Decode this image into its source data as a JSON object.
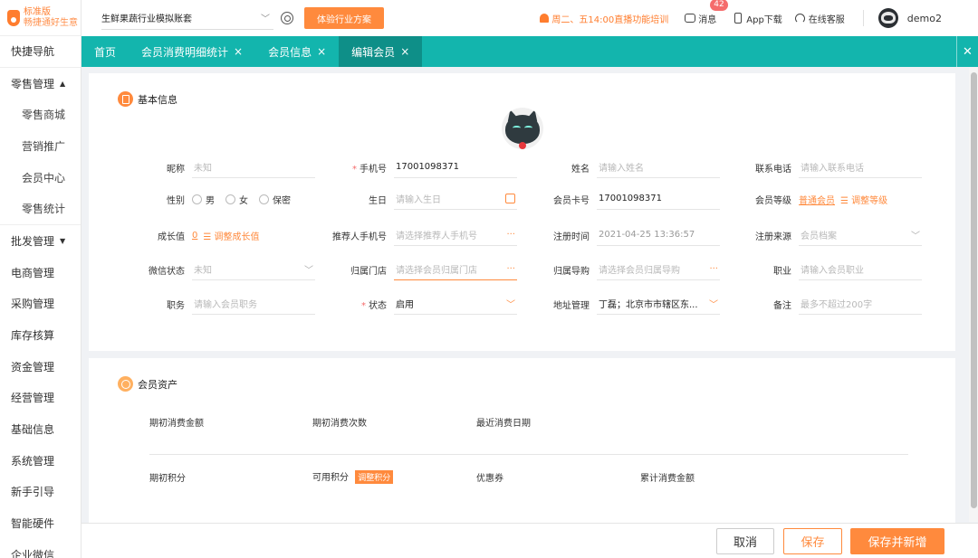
{
  "logo": {
    "line1": "标准版",
    "line2": "畅捷通好生意"
  },
  "sidebar": {
    "shortcut": "快捷导航",
    "retail_group": "零售管理",
    "retail_items": [
      "零售商城",
      "营销推广",
      "会员中心",
      "零售统计"
    ],
    "items": [
      "批发管理",
      "电商管理",
      "采购管理",
      "库存核算",
      "资金管理",
      "经营管理",
      "基础信息",
      "系统管理",
      "新手引导",
      "智能硬件",
      "企业微信"
    ]
  },
  "header": {
    "account": "生鲜果蔬行业模拟账套",
    "trial_button": "体验行业方案",
    "notice": "周二、五14:00直播功能培训",
    "messages_label": "消息",
    "messages_count": "42",
    "app_download": "App下载",
    "service": "在线客服",
    "username": "demo2"
  },
  "tabs": [
    {
      "label": "首页",
      "closable": false
    },
    {
      "label": "会员消费明细统计",
      "closable": true
    },
    {
      "label": "会员信息",
      "closable": true
    },
    {
      "label": "编辑会员",
      "closable": true,
      "active": true
    }
  ],
  "basic": {
    "title": "基本信息",
    "nickname": {
      "label": "昵称",
      "placeholder": "未知"
    },
    "phone": {
      "label": "手机号",
      "value": "17001098371"
    },
    "name": {
      "label": "姓名",
      "placeholder": "请输入姓名"
    },
    "contact": {
      "label": "联系电话",
      "placeholder": "请输入联系电话"
    },
    "gender": {
      "label": "性别",
      "options": [
        "男",
        "女",
        "保密"
      ]
    },
    "birthday": {
      "label": "生日",
      "placeholder": "请输入生日"
    },
    "card_no": {
      "label": "会员卡号",
      "value": "17001098371"
    },
    "level": {
      "label": "会员等级",
      "value": "普通会员",
      "action": "调整等级"
    },
    "growth": {
      "label": "成长值",
      "value": "0",
      "action": "调整成长值"
    },
    "referrer": {
      "label": "推荐人手机号",
      "placeholder": "请选择推荐人手机号"
    },
    "reg_time": {
      "label": "注册时间",
      "value": "2021-04-25 13:36:57"
    },
    "reg_source": {
      "label": "注册来源",
      "placeholder": "会员档案"
    },
    "wechat": {
      "label": "微信状态",
      "placeholder": "未知"
    },
    "store": {
      "label": "归属门店",
      "placeholder": "请选择会员归属门店"
    },
    "guide": {
      "label": "归属导购",
      "placeholder": "请选择会员归属导购"
    },
    "job": {
      "label": "职业",
      "placeholder": "请输入会员职业"
    },
    "position": {
      "label": "职务",
      "placeholder": "请输入会员职务"
    },
    "status": {
      "label": "状态",
      "value": "启用"
    },
    "address": {
      "label": "地址管理",
      "value": "丁磊；北京市市辖区东..."
    },
    "remark": {
      "label": "备注",
      "placeholder": "最多不超过200字"
    }
  },
  "assets": {
    "title": "会员资产",
    "row1": [
      "期初消费金额",
      "期初消费次数",
      "最近消费日期"
    ],
    "initial_points": "期初积分",
    "available_points": "可用积分",
    "adjust_points": "调整积分",
    "coupons": "优惠券",
    "total_spend": "累计消费金额"
  },
  "footer": {
    "cancel": "取消",
    "save": "保存",
    "save_new": "保存并新增"
  },
  "colors": {
    "accent": "#ff8a3d",
    "tabbar": "#13b5ad",
    "tab_active": "#0e8f88"
  }
}
